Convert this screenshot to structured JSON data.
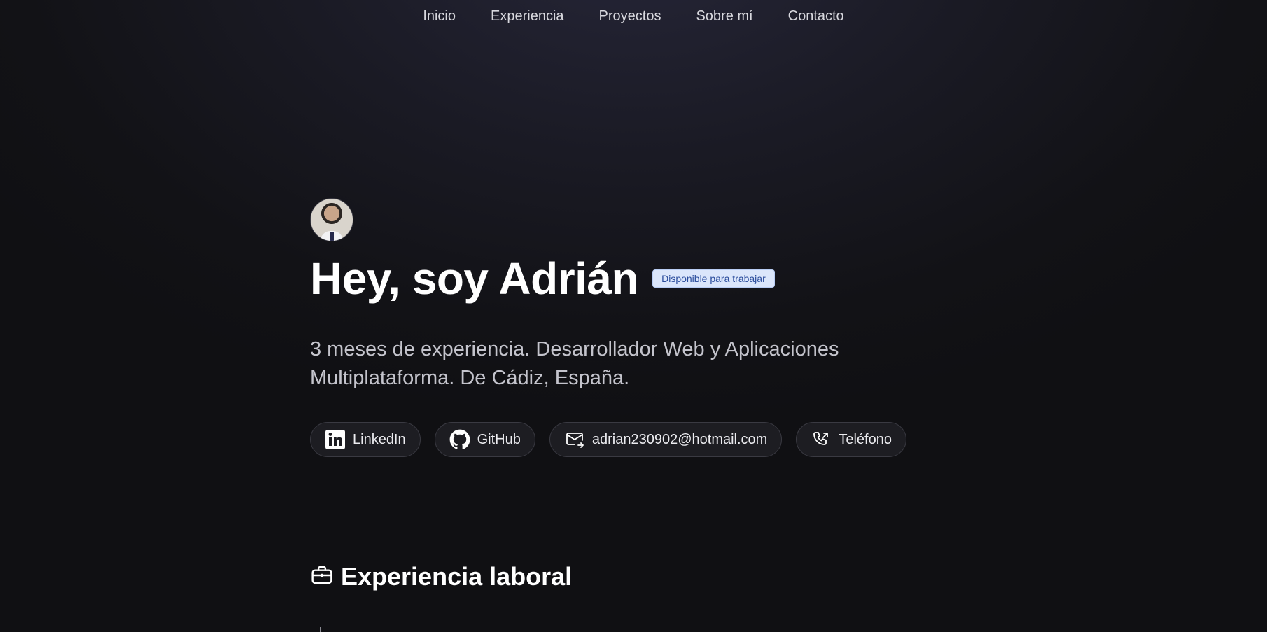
{
  "nav": {
    "items": [
      {
        "label": "Inicio"
      },
      {
        "label": "Experiencia"
      },
      {
        "label": "Proyectos"
      },
      {
        "label": "Sobre mí"
      },
      {
        "label": "Contacto"
      }
    ]
  },
  "hero": {
    "title": "Hey, soy Adrián",
    "badge": "Disponible para trabajar",
    "subtitle": "3 meses de experiencia. Desarrollador Web y Aplicaciones Multiplataforma. De Cádiz, España.",
    "links": [
      {
        "label": "LinkedIn",
        "icon": "linkedin-icon"
      },
      {
        "label": "GitHub",
        "icon": "github-icon"
      },
      {
        "label": "adrian230902@hotmail.com",
        "icon": "mail-icon"
      },
      {
        "label": "Teléfono",
        "icon": "phone-icon"
      }
    ]
  },
  "experience": {
    "title": "Experiencia laboral",
    "icon": "briefcase-icon"
  },
  "colors": {
    "badge_bg": "#dbe6fb",
    "badge_text": "#2a4c9c",
    "background": "#121216"
  }
}
